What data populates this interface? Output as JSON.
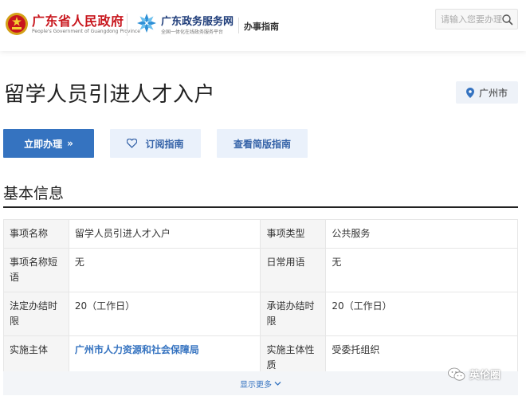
{
  "header": {
    "gov_name": "广东省人民政府",
    "gov_en": "People's Government of Guangdong Province",
    "svc_name": "广东政务服务网",
    "svc_sub": "全国一体化在线政务服务平台",
    "nav_guide": "办事指南",
    "search_placeholder": "请输入您要办理",
    "icons": [
      "national-emblem-icon",
      "service-logo-icon",
      "search-icon"
    ]
  },
  "page": {
    "title": "留学人员引进人才入户",
    "city": "广州市"
  },
  "actions": {
    "apply": "立即办理",
    "apply_arrow": "»",
    "subscribe": "订阅指南",
    "simple": "查看简版指南"
  },
  "section": {
    "title": "基本信息"
  },
  "table": {
    "rows": [
      {
        "label1": "事项名称",
        "value1": "留学人员引进人才入户",
        "label2": "事项类型",
        "value2": "公共服务"
      },
      {
        "label1": "事项名称短语",
        "value1": "无",
        "label2": "日常用语",
        "value2": "无"
      },
      {
        "label1": "法定办结时限",
        "value1": "20（工作日）",
        "label2": "承诺办结时限",
        "value2": "20（工作日）"
      },
      {
        "label1": "实施主体",
        "value1": "广州市人力资源和社会保障局",
        "label2": "实施主体性质",
        "value2": "受委托组织"
      }
    ]
  },
  "show_more": "显示更多",
  "watermark": "英伦圈",
  "colors": {
    "brand_red": "#c8161d",
    "primary_blue": "#3573c0",
    "light_blue": "#eaf1fb"
  }
}
